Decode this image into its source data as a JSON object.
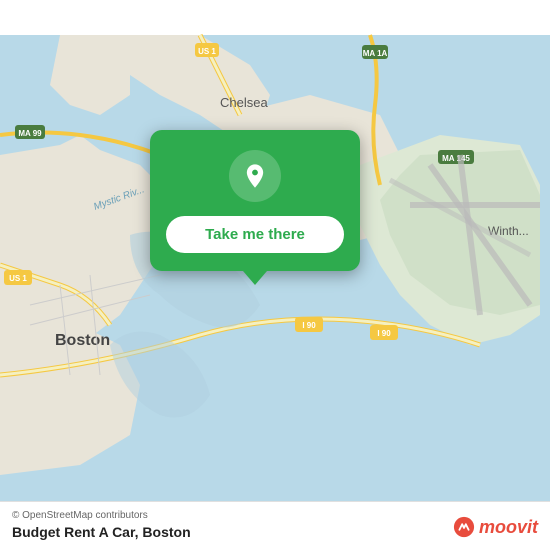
{
  "map": {
    "attribution": "© OpenStreetMap contributors",
    "title": "Budget Rent A Car, Boston",
    "accent_color": "#2eab4e",
    "bg_water": "#b8d9e8",
    "bg_land": "#e8e0d0",
    "bg_road": "#f5f0e8"
  },
  "popup": {
    "button_label": "Take me there",
    "icon": "location-pin-icon"
  },
  "footer": {
    "copyright": "© OpenStreetMap contributors",
    "location_title": "Budget Rent A Car, Boston",
    "moovit_label": "moovit"
  }
}
